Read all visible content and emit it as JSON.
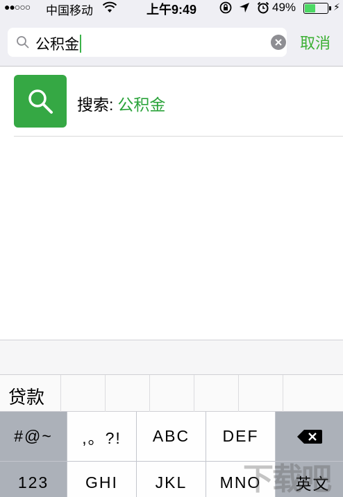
{
  "status_bar": {
    "signal": "●●○○○",
    "carrier": "中国移动",
    "time": "上午9:49",
    "battery_percent": "49%",
    "battery_level": 0.49
  },
  "search": {
    "value": "公积金",
    "cancel_label": "取消"
  },
  "result": {
    "prefix": "搜索:",
    "query": "公积金"
  },
  "keyboard": {
    "candidate": "贷款",
    "row1": [
      "#@~",
      ",。?!",
      "ABC",
      "DEF"
    ],
    "row2": [
      "123",
      "GHI",
      "JKL",
      "MNO",
      "英文"
    ]
  },
  "watermark": "下载吧",
  "colors": {
    "accent": "#3cb034",
    "tile": "#35a844",
    "battery": "#4cd964"
  }
}
